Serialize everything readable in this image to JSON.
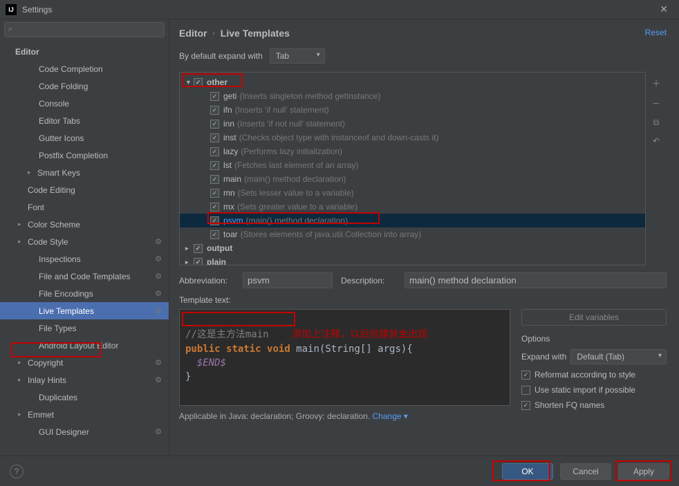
{
  "window": {
    "title": "Settings"
  },
  "search": {
    "placeholder": ""
  },
  "sidebar": {
    "root": "Editor",
    "items": [
      {
        "label": "Code Completion",
        "arrow": false,
        "gear": false
      },
      {
        "label": "Code Folding",
        "arrow": false,
        "gear": false
      },
      {
        "label": "Console",
        "arrow": false,
        "gear": false
      },
      {
        "label": "Editor Tabs",
        "arrow": false,
        "gear": false
      },
      {
        "label": "Gutter Icons",
        "arrow": false,
        "gear": false
      },
      {
        "label": "Postfix Completion",
        "arrow": false,
        "gear": false
      },
      {
        "label": "Smart Keys",
        "arrow": true,
        "gear": false
      },
      {
        "label": "Code Editing",
        "arrow": false,
        "gear": false,
        "outdent": true
      },
      {
        "label": "Font",
        "arrow": false,
        "gear": false,
        "outdent": true
      },
      {
        "label": "Color Scheme",
        "arrow": true,
        "gear": false,
        "outdent": true
      },
      {
        "label": "Code Style",
        "arrow": true,
        "gear": true,
        "outdent": true
      },
      {
        "label": "Inspections",
        "arrow": false,
        "gear": true
      },
      {
        "label": "File and Code Templates",
        "arrow": false,
        "gear": true
      },
      {
        "label": "File Encodings",
        "arrow": false,
        "gear": true
      },
      {
        "label": "Live Templates",
        "arrow": false,
        "gear": true,
        "selected": true
      },
      {
        "label": "File Types",
        "arrow": false,
        "gear": false
      },
      {
        "label": "Android Layout Editor",
        "arrow": false,
        "gear": false
      },
      {
        "label": "Copyright",
        "arrow": true,
        "gear": true,
        "outdent": true
      },
      {
        "label": "Inlay Hints",
        "arrow": true,
        "gear": true,
        "outdent": true
      },
      {
        "label": "Duplicates",
        "arrow": false,
        "gear": false
      },
      {
        "label": "Emmet",
        "arrow": true,
        "gear": false,
        "outdent": true
      },
      {
        "label": "GUI Designer",
        "arrow": false,
        "gear": true
      }
    ]
  },
  "breadcrumb": {
    "a": "Editor",
    "b": "Live Templates",
    "reset": "Reset"
  },
  "expand": {
    "label": "By default expand with",
    "value": "Tab"
  },
  "templates": {
    "group_other": "other",
    "group_output": "output",
    "group_plain": "plain",
    "items": [
      {
        "abbr": "geti",
        "desc": "(Inserts singleton method getInstance)"
      },
      {
        "abbr": "ifn",
        "desc": "(Inserts 'if null' statement)"
      },
      {
        "abbr": "inn",
        "desc": "(Inserts 'if not null' statement)"
      },
      {
        "abbr": "inst",
        "desc": "(Checks object type with instanceof and down-casts it)"
      },
      {
        "abbr": "lazy",
        "desc": "(Performs lazy initialization)"
      },
      {
        "abbr": "lst",
        "desc": "(Fetches last element of an array)"
      },
      {
        "abbr": "main",
        "desc": "(main() method declaration)"
      },
      {
        "abbr": "mn",
        "desc": "(Sets lesser value to a variable)"
      },
      {
        "abbr": "mx",
        "desc": "(Sets greater value to a variable)"
      },
      {
        "abbr": "psvm",
        "desc": "(main() method declaration)",
        "sel": true,
        "hl": true
      },
      {
        "abbr": "toar",
        "desc": "(Stores elements of java.util.Collection into array)"
      }
    ]
  },
  "form": {
    "abbr_label": "Abbreviation:",
    "abbr_value": "psvm",
    "desc_label": "Description:",
    "desc_value": "main() method declaration",
    "tt_label": "Template text:",
    "anno1": "//这是主方法main",
    "anno2": "添加上注释，以后创建就会出现",
    "kw_public": "public ",
    "kw_static": "static ",
    "kw_void": "void",
    "sig": " main(String[] args){",
    "var": "$END$",
    "close": "}"
  },
  "options": {
    "edit_vars": "Edit variables",
    "title": "Options",
    "expand_label": "Expand with",
    "expand_value": "Default (Tab)",
    "reformat": "Reformat according to style",
    "static_import": "Use static import if possible",
    "shorten": "Shorten FQ names"
  },
  "applicable": {
    "text": "Applicable in Java: declaration; Groovy: declaration.",
    "change": "Change"
  },
  "footer": {
    "ok": "OK",
    "cancel": "Cancel",
    "apply": "Apply"
  }
}
